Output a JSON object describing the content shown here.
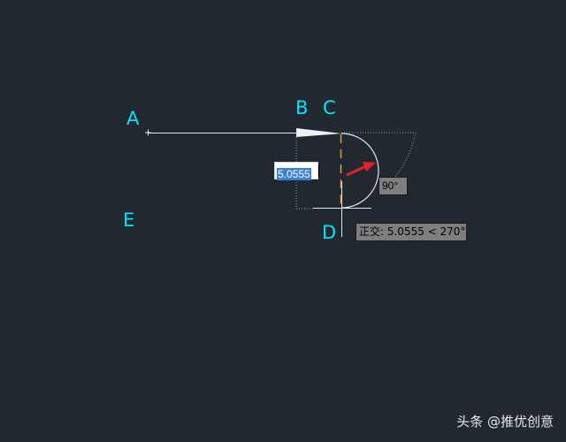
{
  "point_labels": {
    "a": "A",
    "b": "B",
    "c": "C",
    "d": "D",
    "e": "E"
  },
  "dynamic_input": {
    "length_value": "5.0555",
    "angle_value": "90°"
  },
  "ortho_tooltip": "正交: 5.0555 < 270°",
  "watermark": "头条 @推优创意",
  "colors": {
    "background": "#212830",
    "point_label": "#00e5ff",
    "geometry_line": "#e6e6e6",
    "tracking_line": "#e0a030",
    "dotted_preview": "#9aa0a6",
    "direction_arrow": "#e02424",
    "input_selection": "#3a80d4",
    "tooltip_bg": "#7e7e7e"
  }
}
